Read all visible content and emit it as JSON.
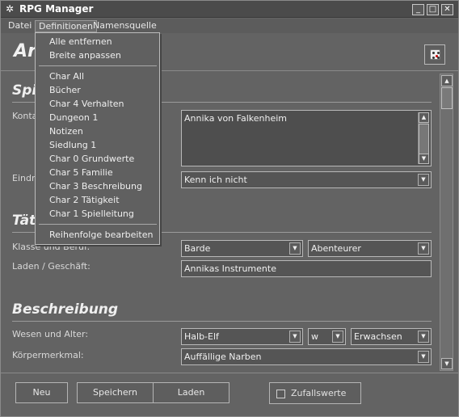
{
  "window": {
    "title": "RPG Manager",
    "controls": {
      "minimize": "_",
      "maximize": "□",
      "close": "✕"
    }
  },
  "menubar": {
    "items": [
      "Datei",
      "Definitionen",
      "Namensquelle"
    ]
  },
  "dropdown": {
    "group1": [
      "Alle entfernen",
      "Breite anpassen"
    ],
    "group2": [
      "Char All",
      "Bücher",
      "Char 4 Verhalten",
      "Dungeon 1",
      "Notizen",
      "Siedlung 1",
      "Char 0 Grundwerte",
      "Char 5 Familie",
      "Char 3 Beschreibung",
      "Char 2 Tätigkeit",
      "Char 1 Spielleitung"
    ],
    "group3": [
      "Reihenfolge bearbeiten"
    ]
  },
  "header": {
    "title_partial": "Ar",
    "dice_icon": "dice-icon"
  },
  "sections": {
    "spielleitung": {
      "title_partial": "Spi",
      "contact_label_partial": "Konta",
      "contact_value": "Annika von Falkenheim",
      "impression_label_partial": "Eindru",
      "impression_value": "Kenn ich nicht"
    },
    "taetigkeit": {
      "title_partial": "Täti",
      "class_label": "Klasse und Beruf:",
      "class_value": "Barde",
      "profession_value": "Abenteurer",
      "shop_label": "Laden / Geschäft:",
      "shop_value": "Annikas Instrumente"
    },
    "beschreibung": {
      "title": "Beschreibung",
      "nature_label": "Wesen und Alter:",
      "race_value": "Halb-Elf",
      "gender_value": "w",
      "age_value": "Erwachsen",
      "feature_label": "Körpermerkmal:",
      "feature_value": "Auffällige Narben"
    }
  },
  "bottom": {
    "new_label": "Neu",
    "save_label": "Speichern",
    "load_label": "Laden",
    "random_label": "Zufallswerte",
    "random_checked": false
  }
}
